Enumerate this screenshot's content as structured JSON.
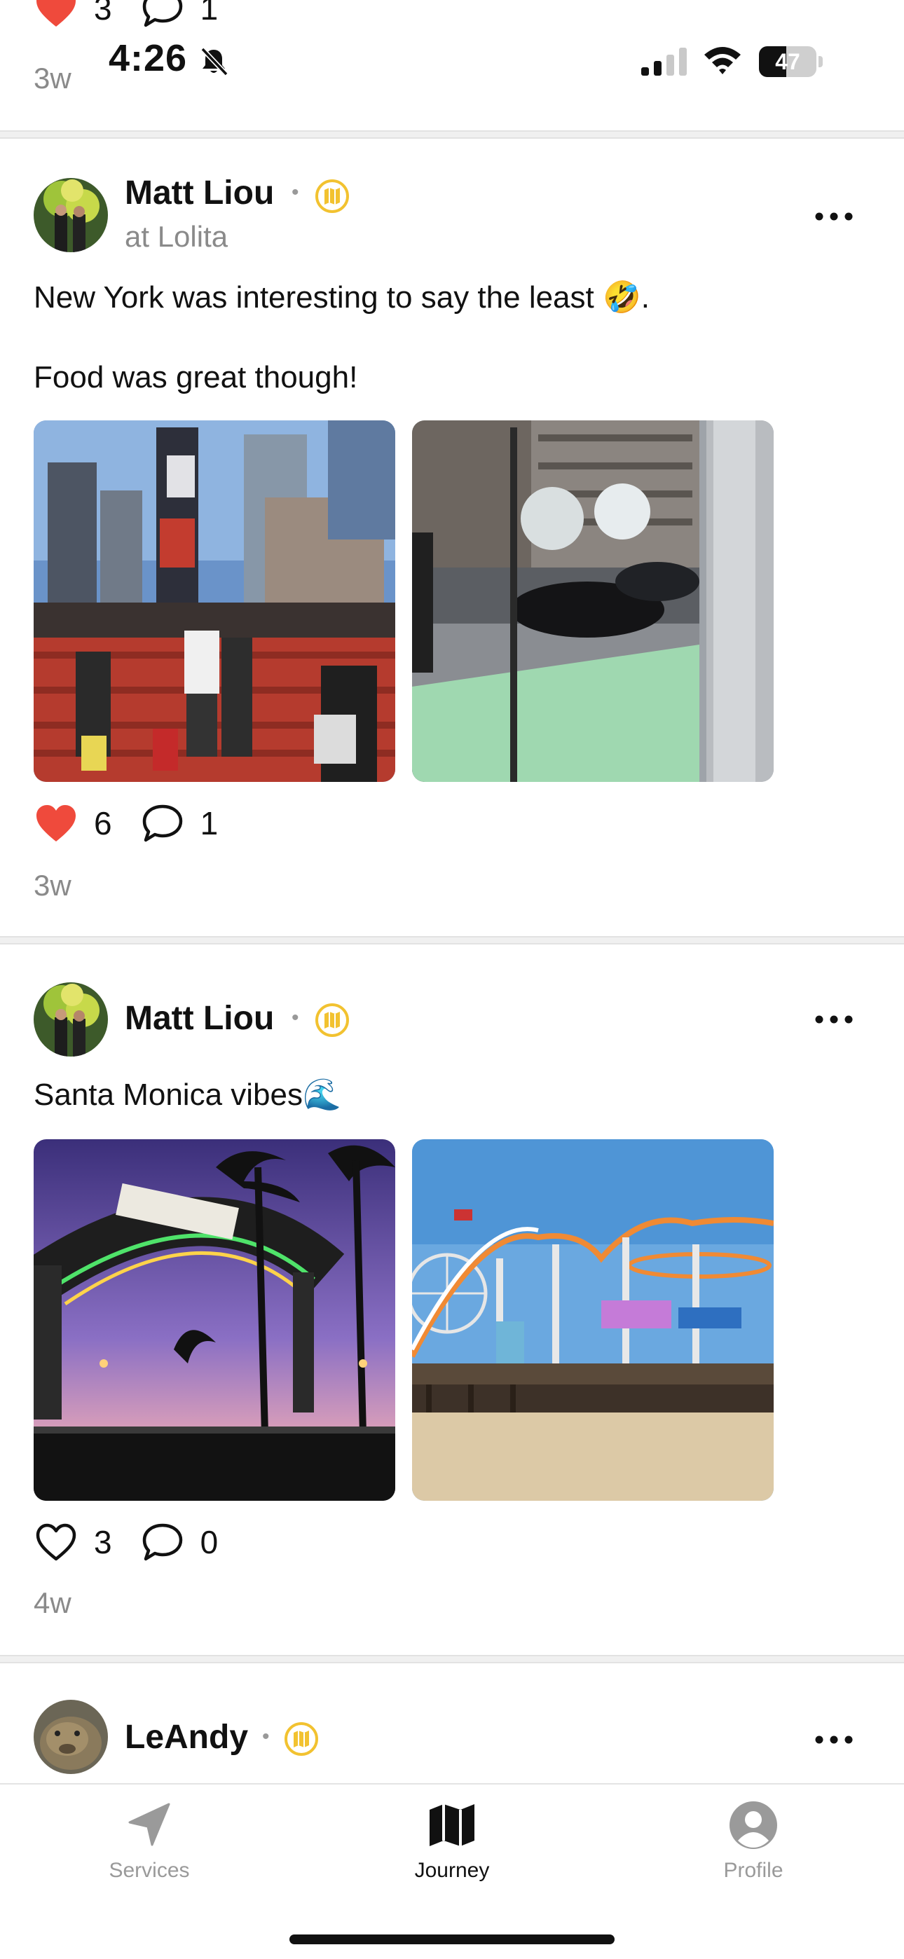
{
  "status_bar": {
    "time": "4:26",
    "battery": "47",
    "battery_level": 0.47
  },
  "previous_post": {
    "likes": "3",
    "comments": "1",
    "age": "3w"
  },
  "posts": [
    {
      "author": "Matt Liou",
      "location": "at Lolita",
      "text_line1": "New York was interesting to say the least 🤣.",
      "text_line2": "Food was great though!",
      "likes": "6",
      "comments": "1",
      "liked": true,
      "age": "3w"
    },
    {
      "author": "Matt Liou",
      "text_line1": "Santa Monica vibes🌊",
      "likes": "3",
      "comments": "0",
      "liked": false,
      "age": "4w"
    },
    {
      "author": "LeAndy"
    }
  ],
  "tabs": [
    {
      "label": "Services",
      "icon": "location-arrow-icon",
      "active": false
    },
    {
      "label": "Journey",
      "icon": "map-icon",
      "active": true
    },
    {
      "label": "Profile",
      "icon": "person-circle-icon",
      "active": false
    }
  ],
  "colors": {
    "like_red": "#ef4a3c",
    "badge_gold": "#f2c230",
    "muted_text": "#8a8a8a",
    "inactive_tab": "#9a9a9a"
  }
}
